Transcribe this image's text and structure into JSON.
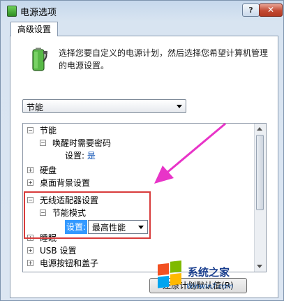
{
  "window": {
    "title": "电源选项",
    "help_label": "?",
    "close_label": "✕"
  },
  "tab": {
    "label": "高级设置"
  },
  "description": "选择您要自定义的电源计划，然后选择您希望计算机管理的电源设置。",
  "plan_select": {
    "value": "节能"
  },
  "tree": {
    "items": [
      {
        "label": "节能",
        "expander": "⊟",
        "level": 0
      },
      {
        "label": "唤醒时需要密码",
        "expander": "⊟",
        "level": 1
      },
      {
        "setting_label": "设置:",
        "setting_value": "是",
        "level": 2
      },
      {
        "label": "硬盘",
        "expander": "⊞",
        "level": 0
      },
      {
        "label": "桌面背景设置",
        "expander": "⊞",
        "level": 0
      },
      {
        "label": "无线适配器设置",
        "expander": "⊟",
        "level": 0
      },
      {
        "label": "节能模式",
        "expander": "⊟",
        "level": 1
      },
      {
        "setting_label": "设置:",
        "setting_value": "最高性能",
        "level": 2
      },
      {
        "label": "睡眠",
        "expander": "⊞",
        "level": 0
      },
      {
        "label": "USB 设置",
        "expander": "⊞",
        "level": 0
      },
      {
        "label": "电源按钮和盖子",
        "expander": "⊞",
        "level": 0
      }
    ]
  },
  "restore_button": {
    "label": "还原计划默认值(R)"
  },
  "watermark": {
    "brand": "系统之家",
    "url": "Winwin7.com"
  },
  "colors": {
    "highlight_box": "#d83b3b",
    "arrow": "#e834c8",
    "selection": "#3399ff"
  }
}
